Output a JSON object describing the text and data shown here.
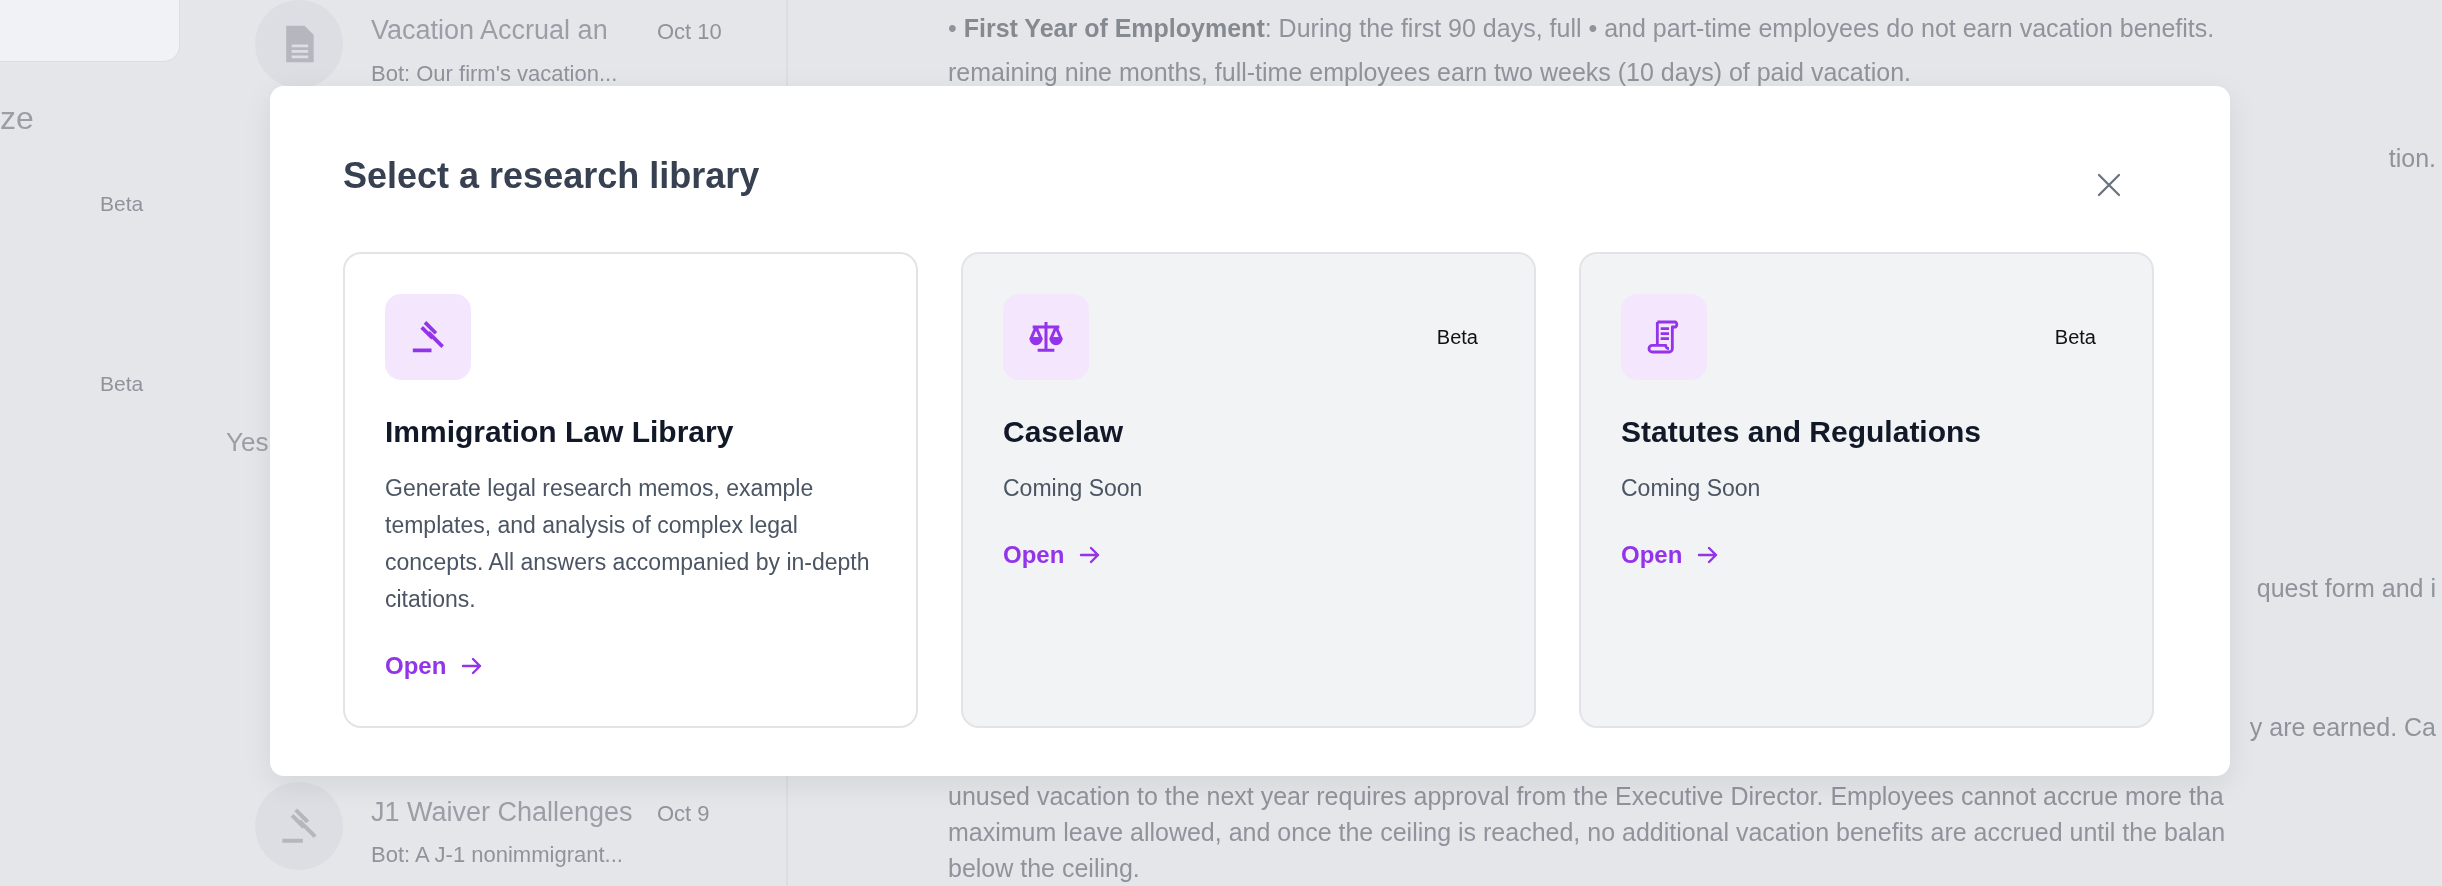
{
  "sidebar": {
    "label": "ze",
    "items": [
      {
        "badge": "Beta"
      },
      {
        "badge": "Beta"
      }
    ],
    "section_label": "Yes"
  },
  "conversations": [
    {
      "title": "Vacation Accrual an",
      "date": "Oct 10",
      "preview": "Bot: Our firm's vacation..."
    },
    {
      "title": "J1 Waiver Challenges",
      "date": "Oct 9",
      "preview": "Bot: A J-1 nonimmigrant..."
    }
  ],
  "document": {
    "paragraphs": [
      {
        "kind": "full",
        "lines": [
          "• **First Year of Employment**: During the first 90 days, full • and part-time employees do not earn vacation benefits.",
          "remaining nine months, full-time employees earn two weeks (10 days) of paid vacation."
        ]
      },
      {
        "kind": "tail",
        "lines": [
          "tion."
        ]
      },
      {
        "kind": "tail",
        "lines": [
          "quest form and i"
        ]
      },
      {
        "kind": "tail",
        "lines": [
          "y are earned. Ca"
        ]
      },
      {
        "kind": "full",
        "lines": [
          "unused vacation to the next year requires approval from the Executive Director. Employees cannot accrue more tha",
          "maximum leave allowed, and once the ceiling is reached, no additional vacation benefits are accrued until the balan",
          "below the ceiling."
        ]
      }
    ]
  },
  "modal": {
    "title": "Select a research library",
    "libraries": [
      {
        "title": "Immigration Law Library",
        "description": "Generate legal research memos, example templates, and analysis of complex legal concepts. All answers accompanied by in-depth citations.",
        "action": "Open",
        "disabled": false
      },
      {
        "title": "Caselaw",
        "badge": "Beta",
        "description": "Coming Soon",
        "action": "Open",
        "disabled": true
      },
      {
        "title": "Statutes and Regulations",
        "badge": "Beta",
        "description": "Coming Soon",
        "action": "Open",
        "disabled": true
      }
    ]
  }
}
